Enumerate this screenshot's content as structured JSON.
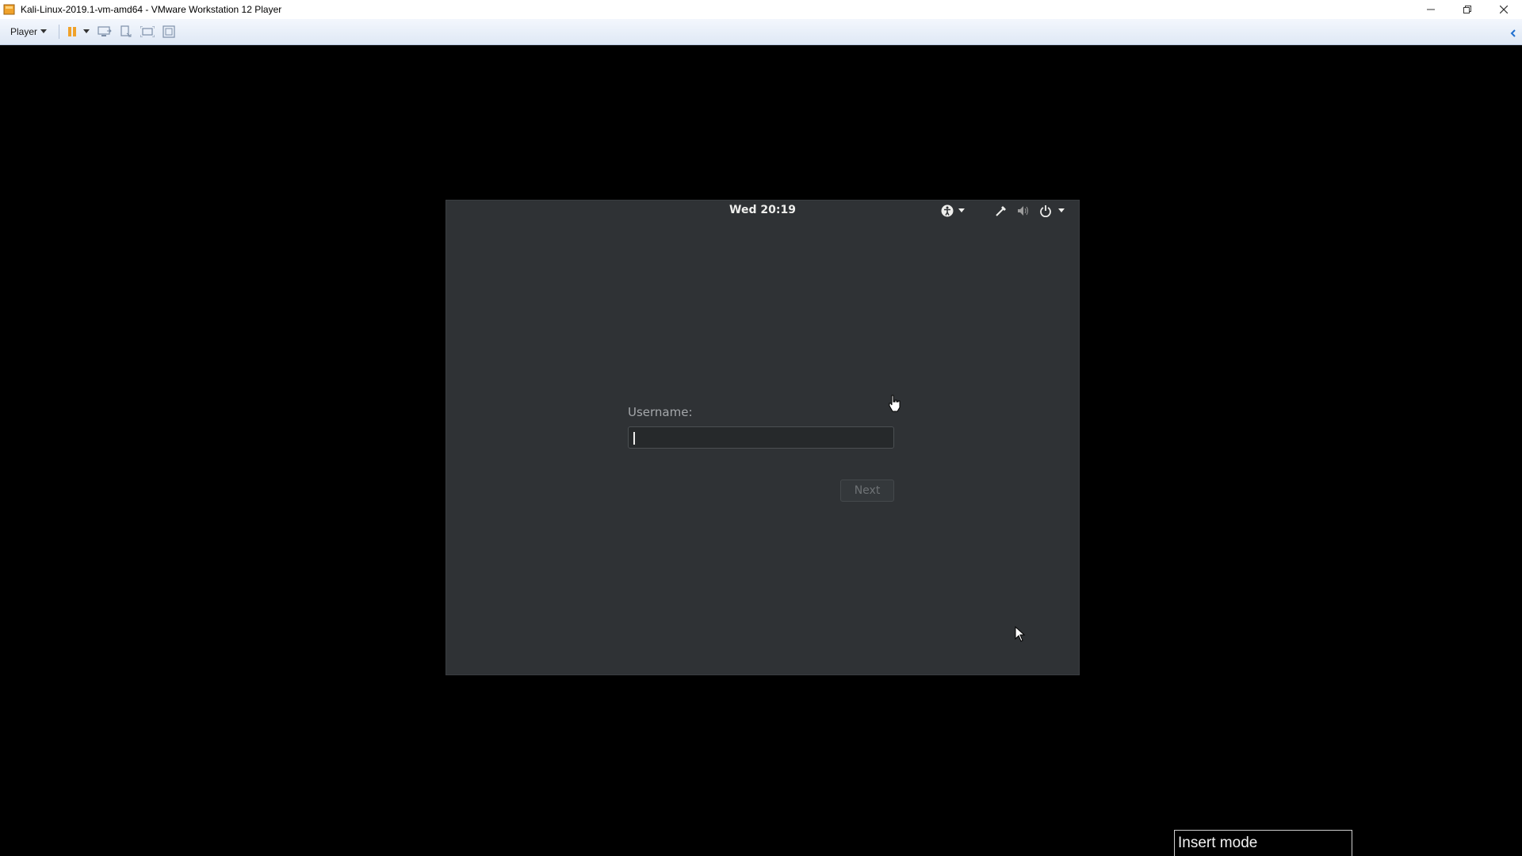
{
  "window": {
    "title": "Kali-Linux-2019.1-vm-amd64 - VMware Workstation 12 Player",
    "controls": {
      "minimize_icon": "minimize-icon",
      "restore_icon": "restore-icon",
      "close_icon": "close-icon"
    }
  },
  "toolbar": {
    "player_label": "Player",
    "icons": [
      "pause-icon",
      "send-ctrl-alt-del-icon",
      "removable-devices-icon",
      "fullscreen-icon",
      "unity-icon"
    ],
    "collapse_icon": "collapse-toolbar-icon"
  },
  "vm": {
    "topbar": {
      "clock": "Wed 20:19",
      "tray_icons": [
        "accessibility-icon",
        "network-icon",
        "volume-icon",
        "power-icon"
      ]
    },
    "login": {
      "username_label": "Username:",
      "username_value": "",
      "next_label": "Next"
    }
  },
  "status": {
    "mode": "Insert mode"
  },
  "colors": {
    "vm_background": "#2f3235",
    "host_background": "#000000",
    "toolbar_accent": "#1f6fcf"
  }
}
